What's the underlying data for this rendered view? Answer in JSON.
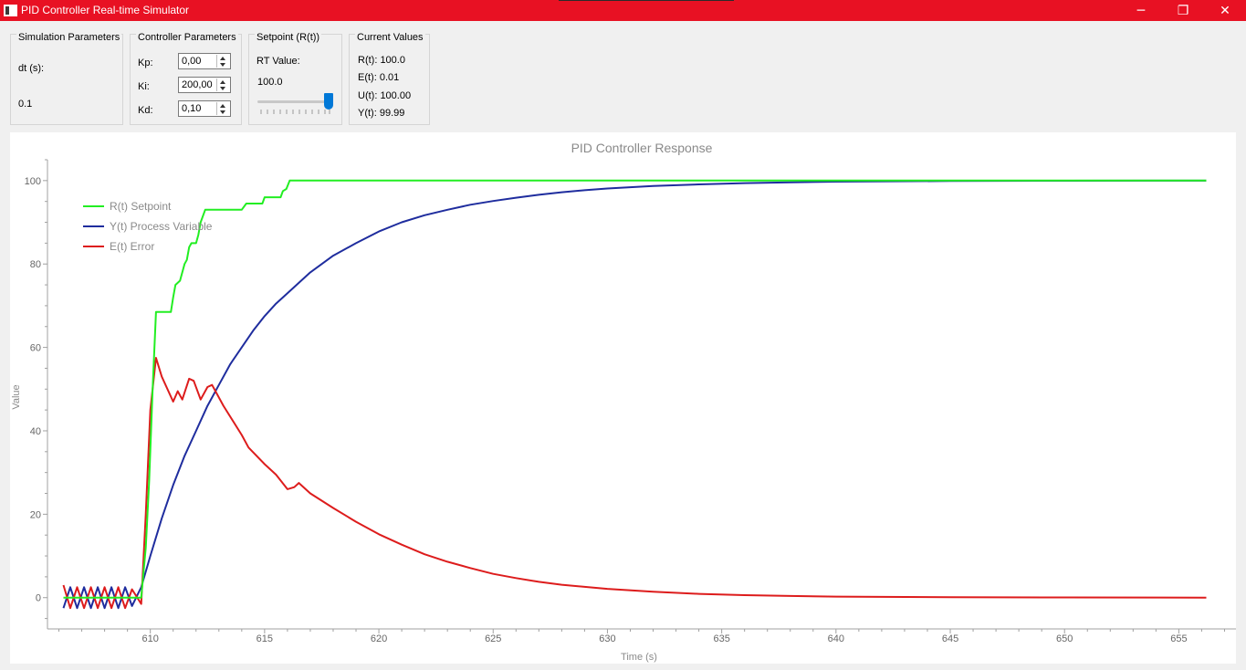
{
  "window": {
    "title": "PID Controller Real-time Simulator",
    "minimize_glyph": "─",
    "restore_glyph": "❐",
    "close_glyph": "✕",
    "accent": "#e81123"
  },
  "simulation": {
    "group_title": "Simulation Parameters",
    "dt_label": "dt (s):",
    "dt_value": "0.1"
  },
  "controller": {
    "group_title": "Controller Parameters",
    "kp_label": "Kp:",
    "kp_value": "0,00",
    "ki_label": "Ki:",
    "ki_value": "200,00",
    "kd_label": "Kd:",
    "kd_value": "0,10"
  },
  "setpoint": {
    "group_title": "Setpoint (R(t))",
    "rt_label": "RT Value:",
    "rt_value": "100.0",
    "slider_level": 1.0
  },
  "current": {
    "group_title": "Current Values",
    "r": "R(t): 100.0",
    "e": "E(t): 0.01",
    "u": "U(t): 100.00",
    "y": "Y(t): 99.99"
  },
  "chart_data": {
    "type": "line",
    "title": "PID Controller Response",
    "xlabel": "Time (s)",
    "ylabel": "Value",
    "xlim": [
      605.5,
      657.5
    ],
    "ylim": [
      -7.5,
      105
    ],
    "xticks": [
      610,
      615,
      620,
      625,
      630,
      635,
      640,
      645,
      650,
      655
    ],
    "yticks": [
      0,
      20,
      40,
      60,
      80,
      100
    ],
    "legend_position": "top-left",
    "grid": false,
    "series": [
      {
        "name": "R(t) Setpoint",
        "color": "#22ee22",
        "points": [
          [
            606.2,
            0
          ],
          [
            609.6,
            0
          ],
          [
            609.8,
            12
          ],
          [
            609.95,
            28
          ],
          [
            610.1,
            50
          ],
          [
            610.25,
            68.5
          ],
          [
            610.9,
            68.5
          ],
          [
            611.0,
            72
          ],
          [
            611.1,
            75
          ],
          [
            611.3,
            76
          ],
          [
            611.5,
            80
          ],
          [
            611.6,
            81
          ],
          [
            611.7,
            84
          ],
          [
            611.8,
            85
          ],
          [
            612.0,
            85
          ],
          [
            612.1,
            87
          ],
          [
            612.2,
            90
          ],
          [
            612.4,
            93
          ],
          [
            614.0,
            93
          ],
          [
            614.2,
            94.5
          ],
          [
            614.9,
            94.5
          ],
          [
            615.0,
            96
          ],
          [
            615.7,
            96
          ],
          [
            615.8,
            97.5
          ],
          [
            615.95,
            98
          ],
          [
            616.1,
            100
          ],
          [
            656.2,
            100
          ]
        ]
      },
      {
        "name": "Y(t) Process Variable",
        "color": "#1f2d9e",
        "points": [
          [
            606.2,
            -2.5
          ],
          [
            606.5,
            2.5
          ],
          [
            606.8,
            -2.5
          ],
          [
            607.1,
            2.5
          ],
          [
            607.4,
            -2.5
          ],
          [
            607.7,
            2.5
          ],
          [
            608.0,
            -2.5
          ],
          [
            608.3,
            2.5
          ],
          [
            608.6,
            -2.5
          ],
          [
            608.9,
            2.5
          ],
          [
            609.2,
            -2
          ],
          [
            609.6,
            2.5
          ],
          [
            610,
            10
          ],
          [
            610.5,
            19
          ],
          [
            611,
            27
          ],
          [
            611.5,
            34
          ],
          [
            612,
            40
          ],
          [
            612.5,
            46
          ],
          [
            613,
            51
          ],
          [
            613.5,
            56
          ],
          [
            614,
            60
          ],
          [
            614.5,
            64
          ],
          [
            615,
            67.5
          ],
          [
            615.5,
            70.5
          ],
          [
            616,
            73
          ],
          [
            617,
            78
          ],
          [
            618,
            82
          ],
          [
            619,
            85
          ],
          [
            620,
            87.8
          ],
          [
            621,
            90
          ],
          [
            622,
            91.7
          ],
          [
            623,
            93
          ],
          [
            624,
            94.2
          ],
          [
            625,
            95.1
          ],
          [
            626,
            95.9
          ],
          [
            627,
            96.6
          ],
          [
            628,
            97.2
          ],
          [
            629,
            97.7
          ],
          [
            630,
            98.1
          ],
          [
            632,
            98.7
          ],
          [
            634,
            99.1
          ],
          [
            636,
            99.4
          ],
          [
            638,
            99.6
          ],
          [
            640,
            99.75
          ],
          [
            645,
            99.9
          ],
          [
            650,
            99.97
          ],
          [
            656.2,
            99.99
          ]
        ]
      },
      {
        "name": "E(t) Error",
        "color": "#dd1c1c",
        "points": [
          [
            606.2,
            3
          ],
          [
            606.5,
            -2.5
          ],
          [
            606.8,
            2.5
          ],
          [
            607.1,
            -2.5
          ],
          [
            607.4,
            2.5
          ],
          [
            607.7,
            -2.5
          ],
          [
            608.0,
            2.5
          ],
          [
            608.3,
            -2.5
          ],
          [
            608.6,
            2.5
          ],
          [
            608.9,
            -2.5
          ],
          [
            609.2,
            2
          ],
          [
            609.6,
            -1.5
          ],
          [
            609.8,
            20
          ],
          [
            610.0,
            45
          ],
          [
            610.25,
            57.5
          ],
          [
            610.5,
            53
          ],
          [
            611.0,
            47
          ],
          [
            611.2,
            49.5
          ],
          [
            611.4,
            47.5
          ],
          [
            611.7,
            52.5
          ],
          [
            611.9,
            52
          ],
          [
            612.2,
            47.5
          ],
          [
            612.5,
            50.5
          ],
          [
            612.7,
            51
          ],
          [
            613.2,
            46
          ],
          [
            614,
            39
          ],
          [
            614.3,
            36
          ],
          [
            615,
            32
          ],
          [
            615.5,
            29.5
          ],
          [
            616.0,
            26
          ],
          [
            616.3,
            26.5
          ],
          [
            616.5,
            27.5
          ],
          [
            617,
            25
          ],
          [
            618,
            21.5
          ],
          [
            619,
            18.2
          ],
          [
            620,
            15.2
          ],
          [
            621,
            12.7
          ],
          [
            622,
            10.4
          ],
          [
            623,
            8.6
          ],
          [
            624,
            7.1
          ],
          [
            625,
            5.7
          ],
          [
            626,
            4.7
          ],
          [
            627,
            3.8
          ],
          [
            628,
            3.1
          ],
          [
            629,
            2.6
          ],
          [
            630,
            2.1
          ],
          [
            632,
            1.4
          ],
          [
            634,
            0.9
          ],
          [
            636,
            0.6
          ],
          [
            638,
            0.4
          ],
          [
            640,
            0.25
          ],
          [
            645,
            0.1
          ],
          [
            650,
            0.05
          ],
          [
            656.2,
            0.01
          ]
        ]
      }
    ]
  }
}
